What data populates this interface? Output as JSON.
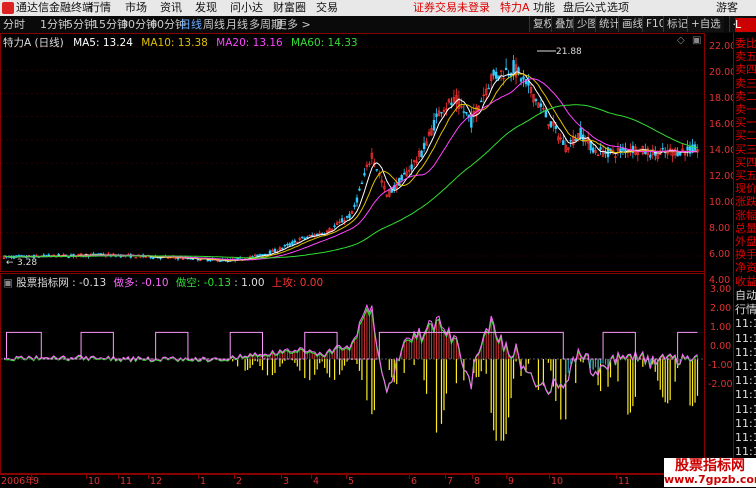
{
  "menubar": {
    "app_title": "通达信金融终端",
    "items": [
      "行情",
      "市场",
      "资讯",
      "发现",
      "问小达",
      "财富圈",
      "交易"
    ],
    "login_status": "证券交易未登录",
    "stock_name": "特力A",
    "right_items": [
      "功能",
      "盘后",
      "公式",
      "选项"
    ],
    "guest": "游客"
  },
  "toolbar": {
    "periods": [
      "分时",
      "1分钟",
      "5分钟",
      "15分钟",
      "30分钟",
      "60分钟",
      "日线",
      "周线",
      "月线",
      "多周期",
      "更多 >"
    ],
    "active_period": "日线",
    "right_buttons": [
      "复权",
      "叠加",
      "少图",
      "统计",
      "画线",
      "F10",
      "标记",
      "+自选",
      "◀"
    ]
  },
  "main_chart": {
    "title": "特力A (日线)",
    "ma": [
      {
        "label": "MA5: 13.24",
        "color": "#ffffff"
      },
      {
        "label": "MA10: 13.38",
        "color": "#e0c000"
      },
      {
        "label": "MA20: 13.16",
        "color": "#ff44ff"
      },
      {
        "label": "MA60: 14.33",
        "color": "#33dd33"
      }
    ],
    "high_label": "21.88",
    "low_label": "3.28",
    "price_ticks": [
      "22.00",
      "20.00",
      "18.00",
      "16.00",
      "14.00",
      "12.00",
      "10.00",
      "8.00",
      "6.00",
      "4.00"
    ]
  },
  "indicator": {
    "title": "股票指标网",
    "value": ": -0.13",
    "series": [
      {
        "label": "做多: -0.10",
        "color": "#ff66ff"
      },
      {
        "label": "做空: -0.13",
        "color": "#33dd33"
      },
      {
        "label": ": 1.00",
        "color": "#dddddd"
      },
      {
        "label": "上攻: 0.00",
        "color": "#ff3333"
      }
    ],
    "ticks": [
      "3.00",
      "2.00",
      "1.00",
      "0.00",
      "-1.00",
      "-2.00"
    ]
  },
  "sidepanel": {
    "top_label": "L",
    "items": [
      "委比",
      "卖五",
      "卖四",
      "卖三",
      "卖二",
      "卖一",
      "买一",
      "买二",
      "买三",
      "买四",
      "买五",
      "现价",
      "涨跌",
      "涨幅",
      "总量",
      "外盘",
      "换手",
      "净资",
      "收益"
    ],
    "lower_items": [
      "自动",
      "行情",
      "11:1",
      "11:1",
      "11:1",
      "11:1",
      "11:1",
      "11:1",
      "11:1",
      "11:1",
      "11:1",
      "11:1"
    ]
  },
  "dates": [
    "2006年",
    "9",
    "10",
    "11",
    "12",
    "1",
    "2",
    "3",
    "4",
    "5",
    "6",
    "7",
    "8",
    "9",
    "10",
    "11",
    "1"
  ],
  "watermark": {
    "line1": "股票指标网",
    "line2": "www.7gpzb.com"
  }
}
